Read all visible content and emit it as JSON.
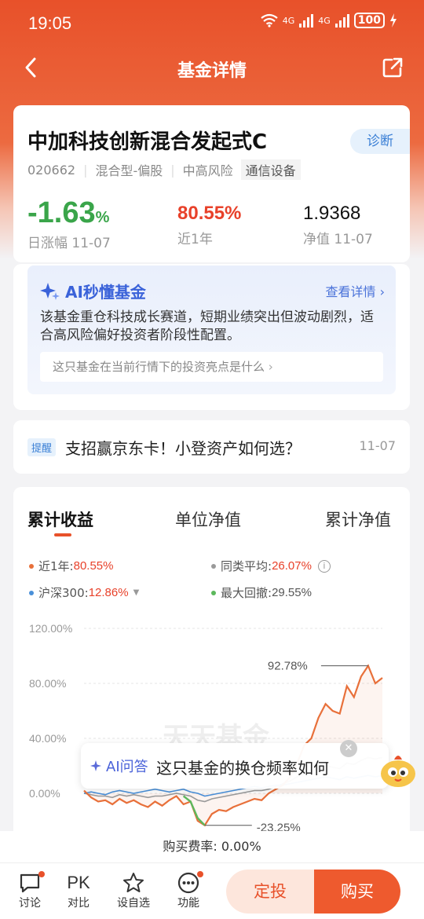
{
  "status": {
    "time": "19:05",
    "battery": "100",
    "network1": "4G",
    "network2": "4G"
  },
  "nav": {
    "title": "基金详情"
  },
  "fund": {
    "name": "中加科技创新混合发起式C",
    "diagnose": "诊断",
    "code": "020662",
    "type": "混合型-偏股",
    "risk": "中高风险",
    "sector": "通信设备",
    "daily_change": "-1.63",
    "daily_change_unit": "%",
    "daily_change_label": "日涨幅 11-07",
    "year_return": "80.55%",
    "year_return_label": "近1年",
    "nav_value": "1.9368",
    "nav_label": "净值 11-07"
  },
  "ai_card": {
    "title": "AI秒懂基金",
    "more": "查看详情",
    "desc": "该基金重仓科技成长赛道，短期业绩突出但波动剧烈，适合高风险偏好投资者阶段性配置。",
    "question": "这只基金在当前行情下的投资亮点是什么"
  },
  "notice": {
    "badge": "提醒",
    "text": "支招赢京东卡！小登资产如何选？",
    "date": "11-07"
  },
  "chart_tabs": [
    "累计收益",
    "单位净值",
    "累计净值"
  ],
  "legend": {
    "fund": {
      "label": "近1年:",
      "value": "80.55%"
    },
    "peer": {
      "label": "同类平均:",
      "value": "26.07%"
    },
    "hs300": {
      "label": "沪深300:",
      "value": "12.86%"
    },
    "drawdown": {
      "label": "最大回撤:",
      "value": "29.55%"
    }
  },
  "chart_data": {
    "type": "line",
    "ylim": [
      -30,
      120
    ],
    "yticks": [
      "120.00%",
      "80.00%",
      "40.00%",
      "0.00%"
    ],
    "ytick_values": [
      120,
      80,
      40,
      0
    ],
    "max_label": "92.78%",
    "min_label": "-23.25%",
    "watermark": "天天基金",
    "series": [
      {
        "name": "近1年",
        "color": "#e8703a",
        "values": [
          2,
          -3,
          -6,
          -5,
          -8,
          -4,
          -7,
          -5,
          -8,
          -10,
          -6,
          -9,
          -5,
          -2,
          -8,
          -6,
          -20,
          -23.25,
          -15,
          -12,
          -13,
          -10,
          -8,
          -6,
          -4,
          -5,
          0,
          3,
          6,
          12,
          22,
          35,
          40,
          55,
          65,
          60,
          58,
          78,
          70,
          85,
          92.78,
          80,
          84
        ]
      },
      {
        "name": "沪深300",
        "color": "#4a90d9",
        "values": [
          0,
          1,
          0,
          -1,
          1,
          2,
          1,
          0,
          1,
          2,
          3,
          2,
          1,
          2,
          3,
          1,
          0,
          -2,
          -1,
          0,
          1,
          2,
          3,
          4,
          5,
          4,
          5,
          6,
          6,
          7,
          8,
          9,
          10,
          11,
          12,
          11,
          10,
          12,
          11,
          12,
          13,
          12,
          12.86
        ]
      },
      {
        "name": "同类平均",
        "color": "#9a9a9a",
        "values": [
          0,
          -1,
          -2,
          -2,
          -3,
          -1,
          -2,
          -1,
          -2,
          -3,
          -2,
          -2,
          -1,
          0,
          -1,
          -2,
          -5,
          -6,
          -4,
          -3,
          -2,
          -1,
          0,
          1,
          2,
          2,
          3,
          5,
          7,
          9,
          12,
          14,
          16,
          18,
          20,
          19,
          18,
          22,
          21,
          24,
          26,
          25,
          26.07
        ]
      },
      {
        "name": "最大回撤",
        "color": "#5cb85c",
        "values": [
          null,
          null,
          null,
          null,
          null,
          null,
          null,
          null,
          null,
          null,
          null,
          null,
          null,
          null,
          -2,
          -6,
          -18,
          -23.25,
          null
        ]
      }
    ]
  },
  "ai_float": {
    "label": "AI问答",
    "text": "这只基金的换仓频率如何"
  },
  "fee": {
    "text": "购买费率: 0.00%"
  },
  "bottom": {
    "discuss": "讨论",
    "pk_icon": "PK",
    "pk": "对比",
    "watch": "设自选",
    "more": "功能",
    "dingtou": "定投",
    "buy": "购买"
  },
  "colors": {
    "brand": "#e8512a",
    "up": "#e8412a",
    "down": "#3aa54a",
    "ai": "#3a62d9"
  }
}
